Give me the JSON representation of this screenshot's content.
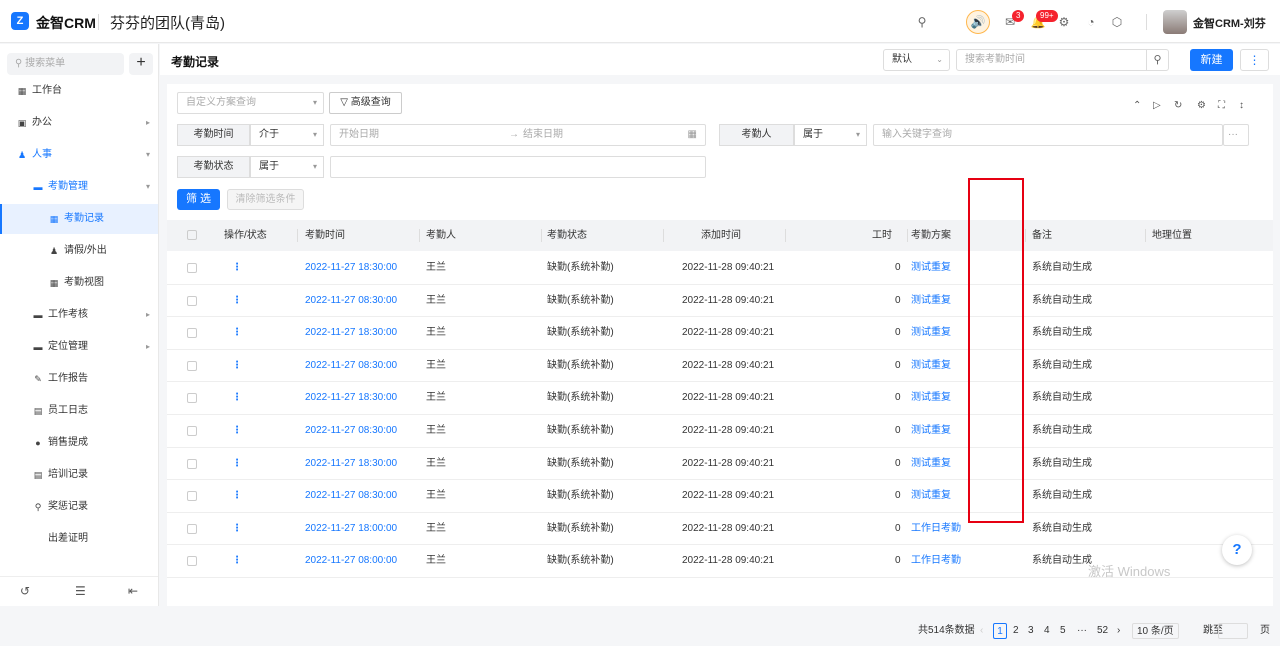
{
  "app": {
    "logo_glyph": "Z",
    "name": "金智CRM",
    "team": "芬芬的团队(青岛)",
    "user": "金智CRM-刘芬",
    "badges": {
      "notify": "3",
      "messages": "99+"
    }
  },
  "sidebar": {
    "search_placeholder": "搜索菜单",
    "add": "+",
    "items": [
      {
        "label": "工作台",
        "icon": "dashboard-icon"
      },
      {
        "label": "办公",
        "icon": "office-icon"
      },
      {
        "label": "人事",
        "icon": "people-icon"
      },
      {
        "label": "考勤管理",
        "icon": "folder-icon"
      },
      {
        "label": "考勤记录",
        "icon": "calendar-icon"
      },
      {
        "label": "请假/外出",
        "icon": "person-icon"
      },
      {
        "label": "考勤视图",
        "icon": "calendar-icon"
      },
      {
        "label": "工作考核",
        "icon": "folder-icon"
      },
      {
        "label": "定位管理",
        "icon": "folder-icon"
      },
      {
        "label": "工作报告",
        "icon": "report-icon"
      },
      {
        "label": "员工日志",
        "icon": "log-icon"
      },
      {
        "label": "销售提成",
        "icon": "coin-icon"
      },
      {
        "label": "培训记录",
        "icon": "training-icon"
      },
      {
        "label": "奖惩记录",
        "icon": "medal-icon"
      },
      {
        "label": "出差证明",
        "icon": ""
      }
    ]
  },
  "header": {
    "title": "考勤记录",
    "view_select": "默认",
    "search_placeholder": "搜索考勤时间",
    "new_btn": "新建",
    "more_btn": "⋮"
  },
  "filters": {
    "scheme_placeholder": "自定义方案查询",
    "advanced": "高级查询",
    "time_label": "考勤时间",
    "time_op": "介于",
    "start_placeholder": "开始日期",
    "end_placeholder": "结束日期",
    "person_label": "考勤人",
    "person_op": "属于",
    "person_placeholder": "输入关键字查询",
    "person_more": "···",
    "status_label": "考勤状态",
    "status_op": "属于",
    "filter_btn": "筛 选",
    "clear_btn": "清除筛选条件"
  },
  "table": {
    "columns": [
      "操作/状态",
      "考勤时间",
      "考勤人",
      "考勤状态",
      "添加时间",
      "工时",
      "考勤方案",
      "",
      "备注",
      "地理位置"
    ],
    "rows": [
      {
        "op": "⋮",
        "time": "2022-11-27 18:30:00",
        "person": "王兰",
        "status": "缺勤(系统补勤)",
        "added": "2022-11-28 09:40:21",
        "hours": "0",
        "scheme": "测试重复",
        "note": "系统自动生成",
        "loc": ""
      },
      {
        "op": "⋮",
        "time": "2022-11-27 08:30:00",
        "person": "王兰",
        "status": "缺勤(系统补勤)",
        "added": "2022-11-28 09:40:21",
        "hours": "0",
        "scheme": "测试重复",
        "note": "系统自动生成",
        "loc": ""
      },
      {
        "op": "⋮",
        "time": "2022-11-27 18:30:00",
        "person": "王兰",
        "status": "缺勤(系统补勤)",
        "added": "2022-11-28 09:40:21",
        "hours": "0",
        "scheme": "测试重复",
        "note": "系统自动生成",
        "loc": ""
      },
      {
        "op": "⋮",
        "time": "2022-11-27 08:30:00",
        "person": "王兰",
        "status": "缺勤(系统补勤)",
        "added": "2022-11-28 09:40:21",
        "hours": "0",
        "scheme": "测试重复",
        "note": "系统自动生成",
        "loc": ""
      },
      {
        "op": "⋮",
        "time": "2022-11-27 18:30:00",
        "person": "王兰",
        "status": "缺勤(系统补勤)",
        "added": "2022-11-28 09:40:21",
        "hours": "0",
        "scheme": "测试重复",
        "note": "系统自动生成",
        "loc": ""
      },
      {
        "op": "⋮",
        "time": "2022-11-27 08:30:00",
        "person": "王兰",
        "status": "缺勤(系统补勤)",
        "added": "2022-11-28 09:40:21",
        "hours": "0",
        "scheme": "测试重复",
        "note": "系统自动生成",
        "loc": ""
      },
      {
        "op": "⋮",
        "time": "2022-11-27 18:30:00",
        "person": "王兰",
        "status": "缺勤(系统补勤)",
        "added": "2022-11-28 09:40:21",
        "hours": "0",
        "scheme": "测试重复",
        "note": "系统自动生成",
        "loc": ""
      },
      {
        "op": "⋮",
        "time": "2022-11-27 08:30:00",
        "person": "王兰",
        "status": "缺勤(系统补勤)",
        "added": "2022-11-28 09:40:21",
        "hours": "0",
        "scheme": "测试重复",
        "note": "系统自动生成",
        "loc": ""
      },
      {
        "op": "⋮",
        "time": "2022-11-27 18:00:00",
        "person": "王兰",
        "status": "缺勤(系统补勤)",
        "added": "2022-11-28 09:40:21",
        "hours": "0",
        "scheme": "工作日考勤",
        "note": "系统自动生成",
        "loc": ""
      },
      {
        "op": "⋮",
        "time": "2022-11-27 08:00:00",
        "person": "王兰",
        "status": "缺勤(系统补勤)",
        "added": "2022-11-28 09:40:21",
        "hours": "0",
        "scheme": "工作日考勤",
        "note": "系统自动生成",
        "loc": ""
      }
    ]
  },
  "pager": {
    "total": "共514条数据",
    "prev": "‹",
    "pages": [
      "1",
      "2",
      "3",
      "4",
      "5"
    ],
    "ellipsis": "···",
    "last": "52",
    "next": "›",
    "page_size": "10 条/页",
    "jump_label": "跳至",
    "unit": "页"
  },
  "watermark": "激活 Windows",
  "help": "?"
}
